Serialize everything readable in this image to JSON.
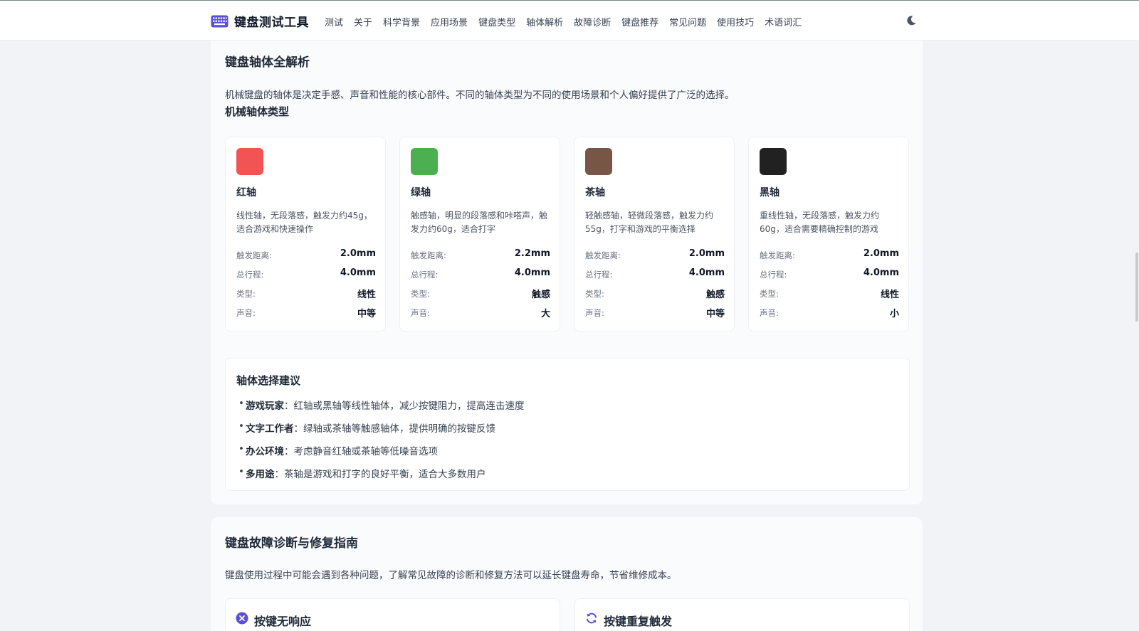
{
  "header": {
    "brand": "键盘测试工具",
    "brand_icon": "keyboard-icon",
    "nav": [
      "测试",
      "关于",
      "科学背景",
      "应用场景",
      "键盘类型",
      "轴体解析",
      "故障诊断",
      "键盘推荐",
      "常见问题",
      "使用技巧",
      "术语词汇"
    ],
    "theme_icon": "moon-icon"
  },
  "switches": {
    "title": "键盘轴体全解析",
    "intro": "机械键盘的轴体是决定手感、声音和性能的核心部件。不同的轴体类型为不同的使用场景和个人偏好提供了广泛的选择。",
    "types_title": "机械轴体类型",
    "labels": {
      "actuation": "触发距离:",
      "travel": "总行程:",
      "type": "类型:",
      "sound": "声音:"
    },
    "cards": [
      {
        "name": "红轴",
        "color": "#f25454",
        "desc": "线性轴，无段落感，触发力约45g，适合游戏和快速操作",
        "actuation": "2.0mm",
        "travel": "4.0mm",
        "type": "线性",
        "sound": "中等"
      },
      {
        "name": "绿轴",
        "color": "#4caf50",
        "desc": "触感轴，明显的段落感和咔嗒声，触发力约60g，适合打字",
        "actuation": "2.2mm",
        "travel": "4.0mm",
        "type": "触感",
        "sound": "大"
      },
      {
        "name": "茶轴",
        "color": "#795548",
        "desc": "轻触感轴，轻微段落感，触发力约55g，打字和游戏的平衡选择",
        "actuation": "2.0mm",
        "travel": "4.0mm",
        "type": "触感",
        "sound": "中等"
      },
      {
        "name": "黑轴",
        "color": "#212121",
        "desc": "重线性轴，无段落感，触发力约60g，适合需要精确控制的游戏",
        "actuation": "2.0mm",
        "travel": "4.0mm",
        "type": "线性",
        "sound": "小"
      }
    ],
    "advice": {
      "title": "轴体选择建议",
      "items": [
        {
          "term": "游戏玩家",
          "text": "：红轴或黑轴等线性轴体，减少按键阻力，提高连击速度"
        },
        {
          "term": "文字工作者",
          "text": "：绿轴或茶轴等触感轴体，提供明确的按键反馈"
        },
        {
          "term": "办公环境",
          "text": "：考虑静音红轴或茶轴等低噪音选项"
        },
        {
          "term": "多用途",
          "text": "：茶轴是游戏和打字的良好平衡，适合大多数用户"
        }
      ]
    }
  },
  "diagnosis": {
    "title": "键盘故障诊断与修复指南",
    "intro": "键盘使用过程中可能会遇到各种问题，了解常见故障的诊断和修复方法可以延长键盘寿命，节省维修成本。",
    "issues": [
      {
        "title": "按键无响应",
        "icon": "x-circle-icon"
      },
      {
        "title": "按键重复触发",
        "icon": "refresh-icon"
      }
    ],
    "accent": "#5b4fd6"
  }
}
